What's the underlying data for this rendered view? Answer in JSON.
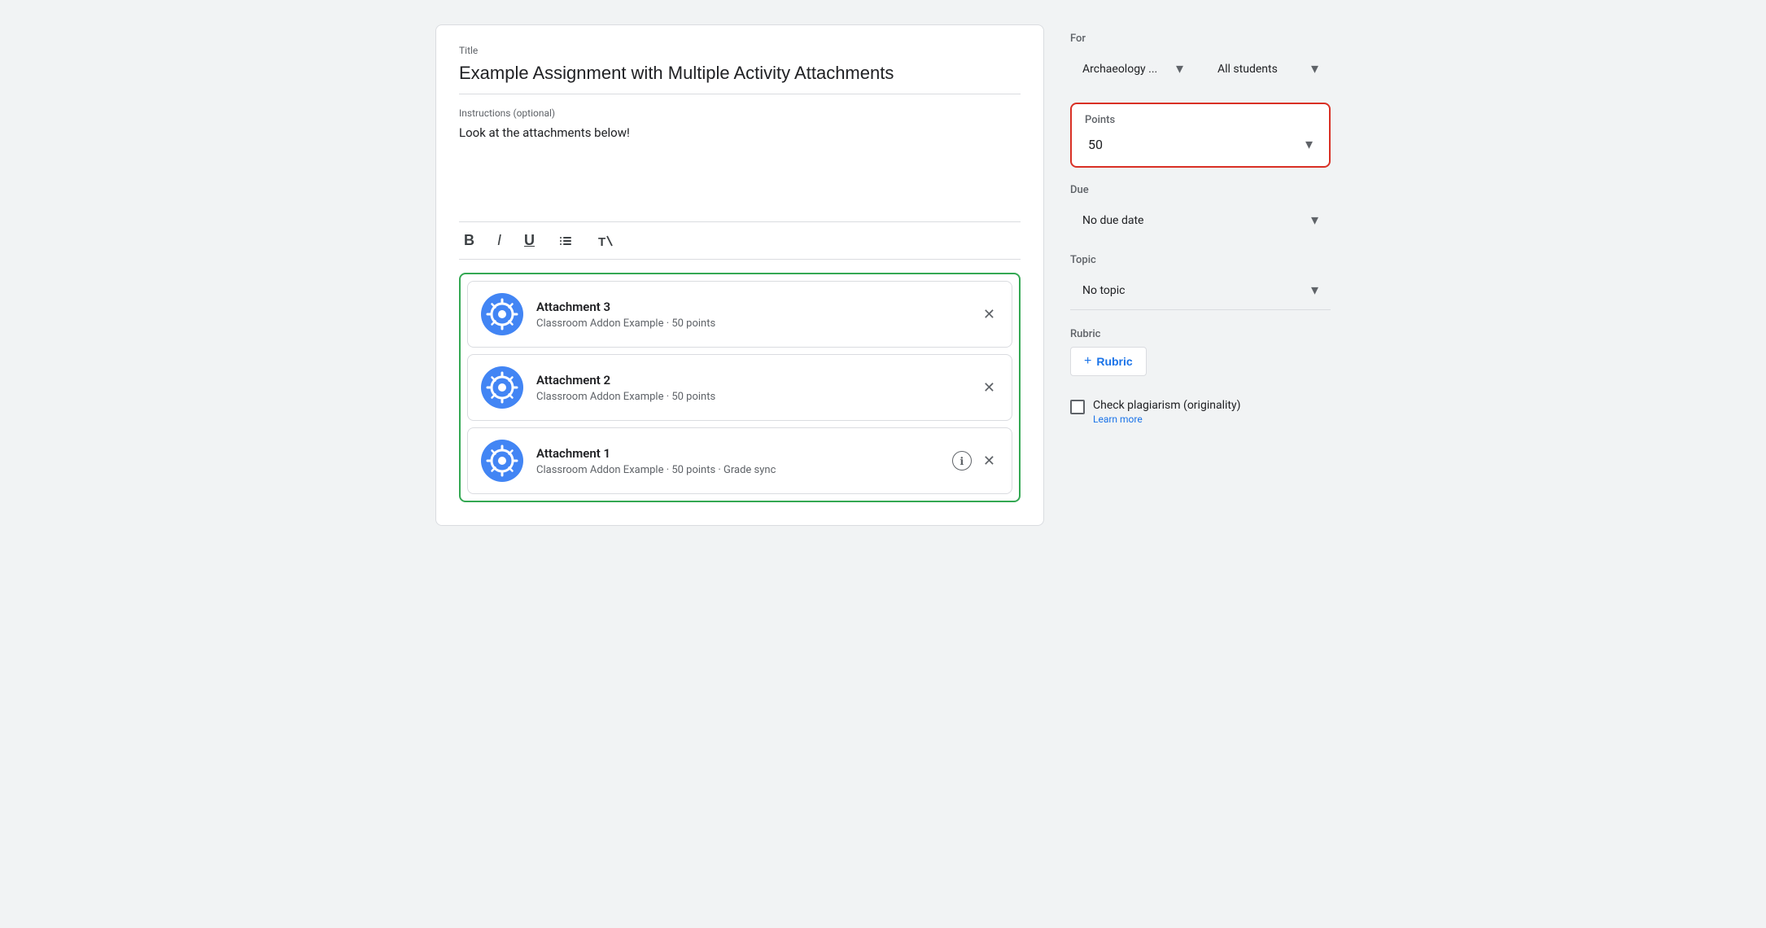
{
  "left": {
    "title_label": "Title",
    "title_value": "Example Assignment with Multiple Activity Attachments",
    "instructions_label": "Instructions (optional)",
    "instructions_value": "Look at the attachments below!",
    "toolbar": {
      "bold": "B",
      "italic": "I",
      "underline": "U",
      "list": "≡",
      "clear": "✕"
    },
    "attachments": [
      {
        "title": "Attachment 3",
        "subtitle": "Classroom Addon Example · 50 points",
        "has_info": false
      },
      {
        "title": "Attachment 2",
        "subtitle": "Classroom Addon Example · 50 points",
        "has_info": false
      },
      {
        "title": "Attachment 1",
        "subtitle": "Classroom Addon Example · 50 points · Grade sync",
        "has_info": true
      }
    ]
  },
  "right": {
    "for_label": "For",
    "class_dropdown": "Archaeology ...",
    "students_dropdown": "All students",
    "points_label": "Points",
    "points_value": "50",
    "due_label": "Due",
    "due_value": "No due date",
    "topic_label": "Topic",
    "topic_value": "No topic",
    "rubric_label": "Rubric",
    "rubric_btn": "Rubric",
    "rubric_plus": "+",
    "plagiarism_label": "Check plagiarism (originality)",
    "learn_more": "Learn more"
  }
}
